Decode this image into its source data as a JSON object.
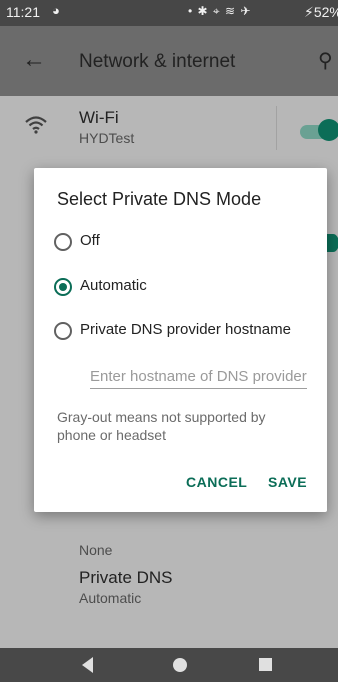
{
  "status_bar": {
    "time": "11:21",
    "notification_icon": "circle-notification-icon",
    "icons": "• ✱ ⌖ ≋ ✈",
    "battery": "⚡52%"
  },
  "app_bar": {
    "title": "Network & internet"
  },
  "settings": {
    "wifi": {
      "title": "Wi-Fi",
      "subtitle": "HYDTest",
      "enabled": true
    },
    "behind_item_subtitle": "None",
    "private_dns": {
      "title": "Private DNS",
      "subtitle": "Automatic"
    }
  },
  "dialog": {
    "title": "Select Private DNS Mode",
    "options": [
      {
        "label": "Off",
        "selected": false
      },
      {
        "label": "Automatic",
        "selected": true
      },
      {
        "label": "Private DNS provider hostname",
        "selected": false
      }
    ],
    "hostname_placeholder": "Enter hostname of DNS provider",
    "hint": "Gray-out means not supported by phone or headset",
    "cancel_label": "CANCEL",
    "save_label": "SAVE"
  },
  "colors": {
    "accent": "#0b6d57",
    "scrim": "#b7b7b7"
  }
}
